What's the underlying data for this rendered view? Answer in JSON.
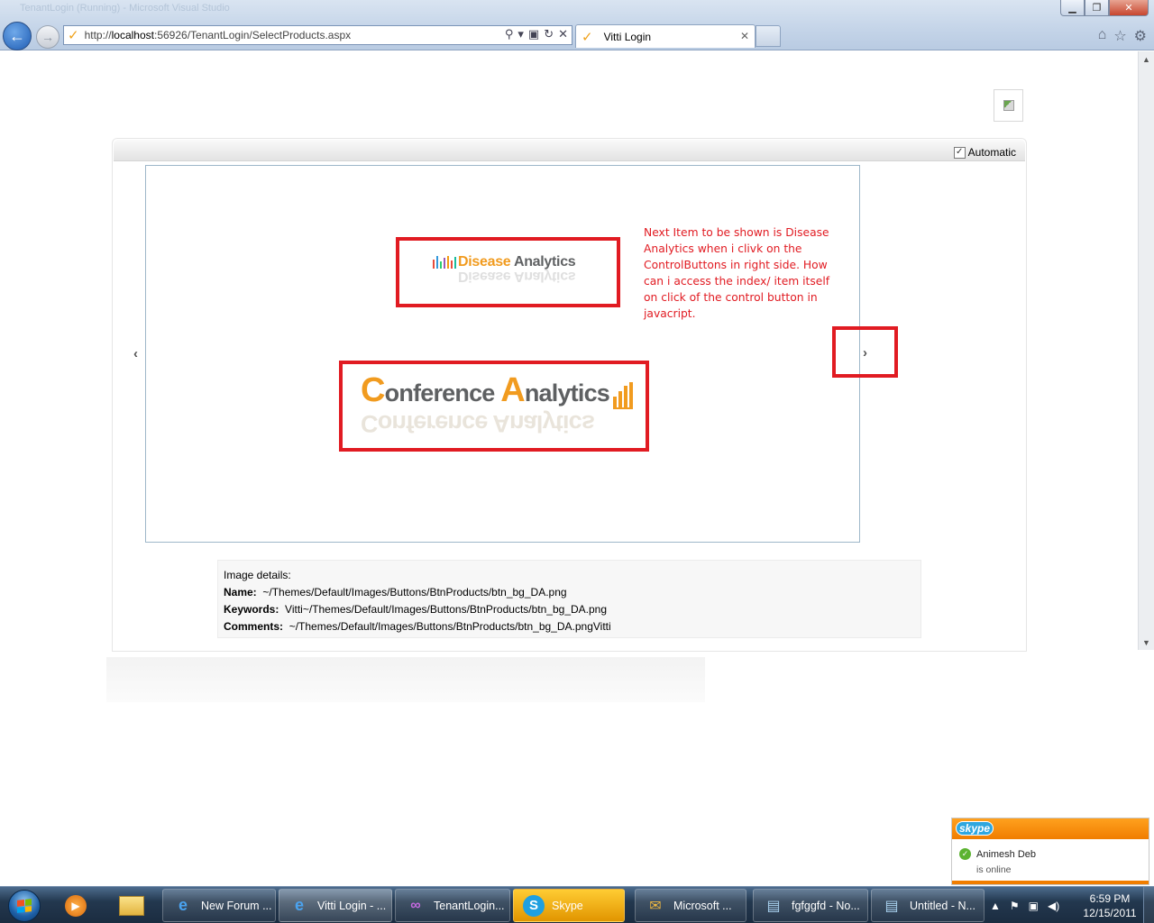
{
  "browser": {
    "window_title": "TenantLogin (Running) - Microsoft Visual Studio",
    "address": {
      "prefix": "http://",
      "host": "localhost",
      "rest": ":56926/TenantLogin/SelectProducts.aspx"
    },
    "tab_label": "Vitti Login",
    "back_label": "←",
    "forward_label": "→"
  },
  "rotator": {
    "automatic_label": "Automatic",
    "automatic_checked": true,
    "prev_arrow": "‹",
    "next_arrow": "›"
  },
  "logos": {
    "disease": {
      "word1": "Disease",
      "word2": " Analytics"
    },
    "conference": {
      "c": "C",
      "word1": "onference ",
      "a": "A",
      "word2": "nalytics"
    }
  },
  "annotation": "Next Item to be shown is Disease Analytics when i clivk on the ControlButtons in right side. How can i access the index/ item itself on click of the control button in javacript.",
  "image_details": {
    "heading": "Image details:",
    "name_label": "Name:",
    "name_value": "~/Themes/Default/Images/Buttons/BtnProducts/btn_bg_DA.png",
    "keywords_label": "Keywords:",
    "keywords_value": "Vitti~/Themes/Default/Images/Buttons/BtnProducts/btn_bg_DA.png",
    "comments_label": "Comments:",
    "comments_value": "~/Themes/Default/Images/Buttons/BtnProducts/btn_bg_DA.pngVitti"
  },
  "skype_popup": {
    "logo": "skype",
    "name": "Animesh Deb",
    "status": "is online"
  },
  "taskbar": {
    "items": [
      {
        "label": "New Forum ..."
      },
      {
        "label": "Vitti Login - ..."
      },
      {
        "label": "TenantLogin..."
      },
      {
        "label": "Skype"
      },
      {
        "label": "Microsoft ..."
      },
      {
        "label": "fgfggfd - No..."
      },
      {
        "label": "Untitled - N..."
      }
    ],
    "time": "6:59 PM",
    "date": "12/15/2011"
  },
  "colors": {
    "annotation_red": "#e11b22",
    "brand_orange": "#f19b1f",
    "skype_orange": "#f07d00"
  }
}
